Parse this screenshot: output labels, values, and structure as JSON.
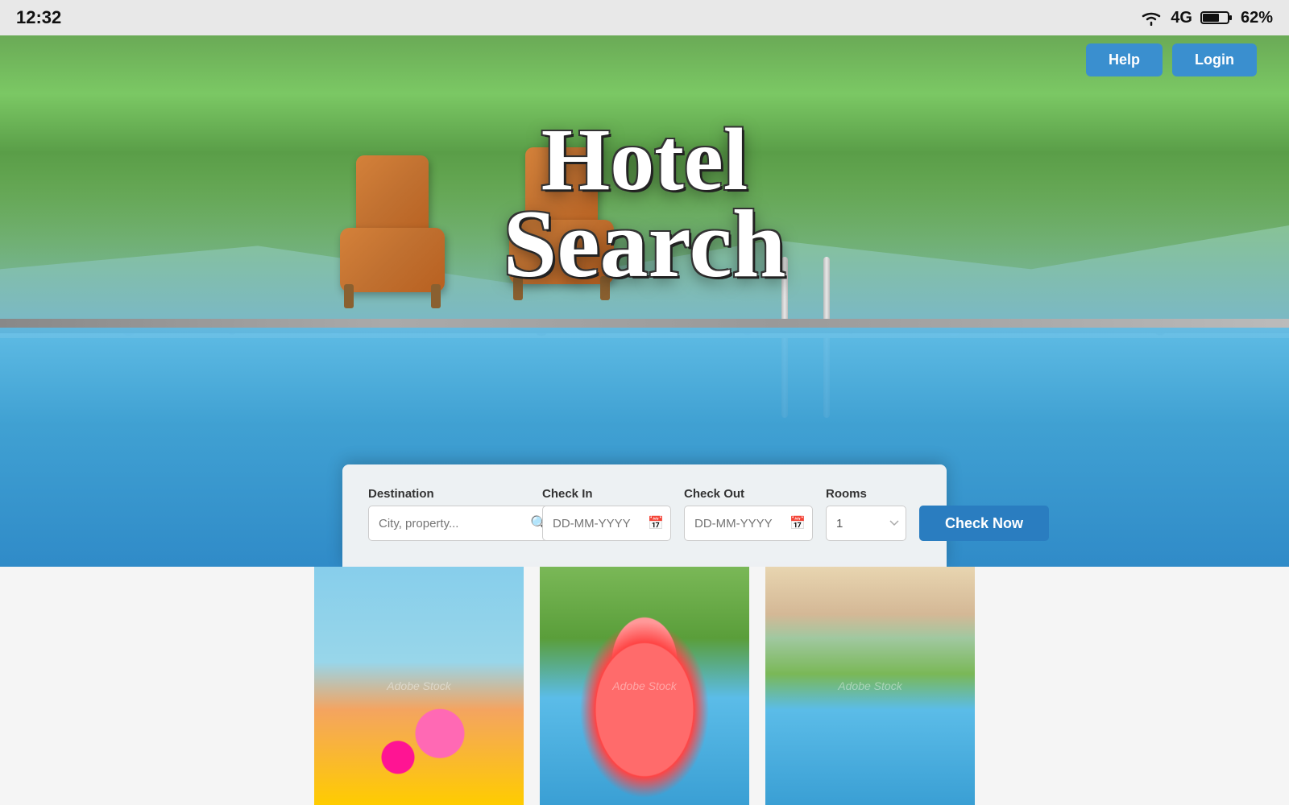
{
  "statusBar": {
    "time": "12:32",
    "network": "4G",
    "battery": "62%"
  },
  "navbar": {
    "helpLabel": "Help",
    "loginLabel": "Login"
  },
  "hero": {
    "titleLine1": "Hotel",
    "titleLine2": "Search"
  },
  "searchPanel": {
    "destinationLabel": "Destination",
    "destinationPlaceholder": "City, property...",
    "checkInLabel": "Check In",
    "checkInPlaceholder": "DD-MM-YYYY",
    "checkOutLabel": "Check Out",
    "checkOutPlaceholder": "DD-MM-YYYY",
    "roomsLabel": "Rooms",
    "roomsValue": "1",
    "checkNowLabel": "Check Now"
  },
  "gallery": {
    "watermark1": "Adobe Stock",
    "watermark2": "Adobe Stock",
    "watermark3": "Adobe Stock"
  },
  "icons": {
    "calendar": "📅",
    "dropdown": "▾",
    "wifi": "wifi",
    "battery": "battery"
  }
}
